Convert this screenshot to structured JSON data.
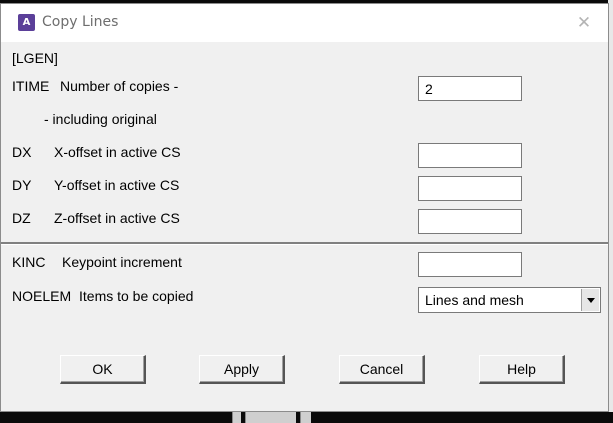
{
  "window": {
    "title": "Copy Lines",
    "app_icon_letter": "A",
    "close_glyph": "✕"
  },
  "command": "[LGEN]",
  "rows": {
    "itime": {
      "key": "ITIME",
      "label": "Number of copies -",
      "sublabel": "- including original",
      "value": "2"
    },
    "dx": {
      "key": "DX",
      "label": "X-offset in active CS",
      "value": ""
    },
    "dy": {
      "key": "DY",
      "label": "Y-offset in active CS",
      "value": ""
    },
    "dz": {
      "key": "DZ",
      "label": "Z-offset in active CS",
      "value": ""
    },
    "kinc": {
      "key": "KINC",
      "label": "Keypoint increment",
      "value": ""
    },
    "noelem": {
      "key": "NOELEM",
      "label": "Items to be copied",
      "selected": "Lines and mesh"
    }
  },
  "buttons": {
    "ok": "OK",
    "apply": "Apply",
    "cancel": "Cancel",
    "help": "Help"
  }
}
